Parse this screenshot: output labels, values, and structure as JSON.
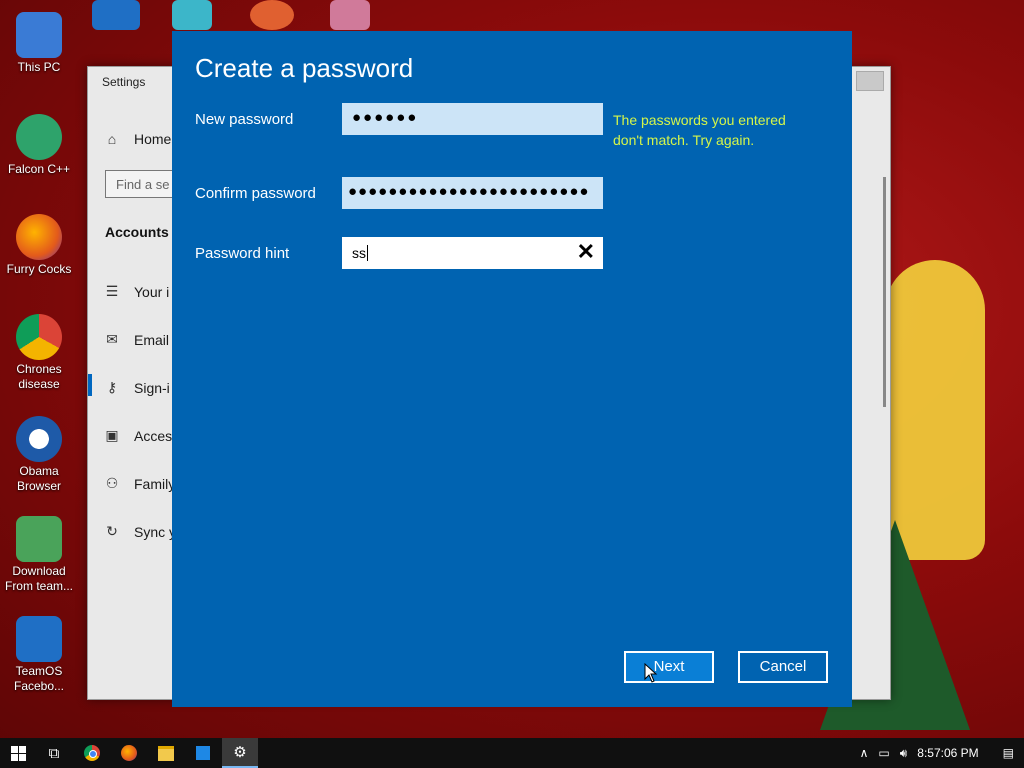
{
  "desktop": {
    "icons": [
      {
        "label": "This PC"
      },
      {
        "label": "Falcon C++"
      },
      {
        "label": "Furry Cocks"
      },
      {
        "label": "Chrones disease"
      },
      {
        "label": "Obama Browser"
      },
      {
        "label": "Download From team..."
      },
      {
        "label": "TeamOS Facebo..."
      }
    ]
  },
  "settings_window": {
    "title": "Settings",
    "nav": {
      "home": "Home",
      "search_placeholder": "Find a se",
      "section": "Accounts",
      "items": [
        "Your i",
        "Email",
        "Sign-i",
        "Acces",
        "Family",
        "Sync y"
      ]
    }
  },
  "dialog": {
    "title": "Create a password",
    "new_password": {
      "label": "New password",
      "masked": "●●●●●●"
    },
    "confirm_password": {
      "label": "Confirm password",
      "masked": "●●●●●●●●●●●●●●●●●●●●●●●●"
    },
    "hint": {
      "label": "Password hint",
      "value": "ss"
    },
    "error": "The passwords you entered don't match. Try again.",
    "next_label": "Next",
    "cancel_label": "Cancel"
  },
  "taskbar": {
    "time": "8:57:06 PM"
  },
  "colors": {
    "dialog_bg": "#0063b1",
    "error_text": "#d4f54a",
    "desktop_bg": "#8c0b0b"
  }
}
